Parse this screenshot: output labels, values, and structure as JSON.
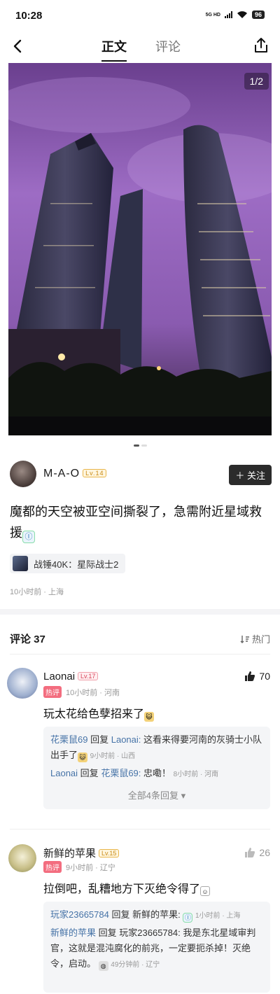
{
  "status": {
    "time": "10:28",
    "network": "5G HD",
    "battery": "96"
  },
  "header": {
    "tab_main": "正文",
    "tab_comments": "评论"
  },
  "image": {
    "page_indicator": "1/2"
  },
  "author": {
    "name": "M-A-O",
    "level": "Lv.14",
    "follow_label": "关注"
  },
  "post": {
    "text": "魔都的天空被亚空间撕裂了，急需附近星域救援",
    "game_tag": "战锤40K：星际战士2",
    "meta": "10小时前 · 上海"
  },
  "comments_header": {
    "title": "评论 37",
    "sort_label": "热门"
  },
  "comments": [
    {
      "name": "Laonai",
      "level": "Lv.17",
      "hot": "热评",
      "meta": "10小时前 · 河南",
      "text": "玩太花给色孽招来了",
      "likes": "70",
      "replies": [
        {
          "user": "花栗鼠69",
          "verb": "回复",
          "target": "Laonai:",
          "text": "这看来得要河南的灰骑士小队出手了",
          "meta": "9小时前 · 山西"
        },
        {
          "user": "Laonai",
          "verb": "回复",
          "target": "花栗鼠69:",
          "text": "忠嘞！",
          "meta": "8小时前 · 河南"
        }
      ],
      "more": "全部4条回复"
    },
    {
      "name": "新鲜的苹果",
      "level": "Lv.15",
      "hot": "热评",
      "meta": "9小时前 · 辽宁",
      "text": "拉倒吧，乱糟地方下灭绝令得了",
      "likes": "26",
      "replies": [
        {
          "user": "玩家23665784",
          "verb": "回复",
          "target": "新鲜的苹果:",
          "text": "",
          "meta": "1小时前 · 上海"
        },
        {
          "user": "新鲜的苹果",
          "verb": "回复",
          "target": "玩家23665784:",
          "text": "我是东北星域审判官，这就是混沌腐化的前兆，一定要扼杀掉！灭绝令，启动。",
          "meta": "49分钟前 · 辽宁"
        }
      ]
    }
  ],
  "colors": {
    "sky_purple": "#8a5bb0",
    "hot_tag": "#f36d7f",
    "level_gold": "#e8b54a",
    "reply_blue": "#4673a7"
  }
}
